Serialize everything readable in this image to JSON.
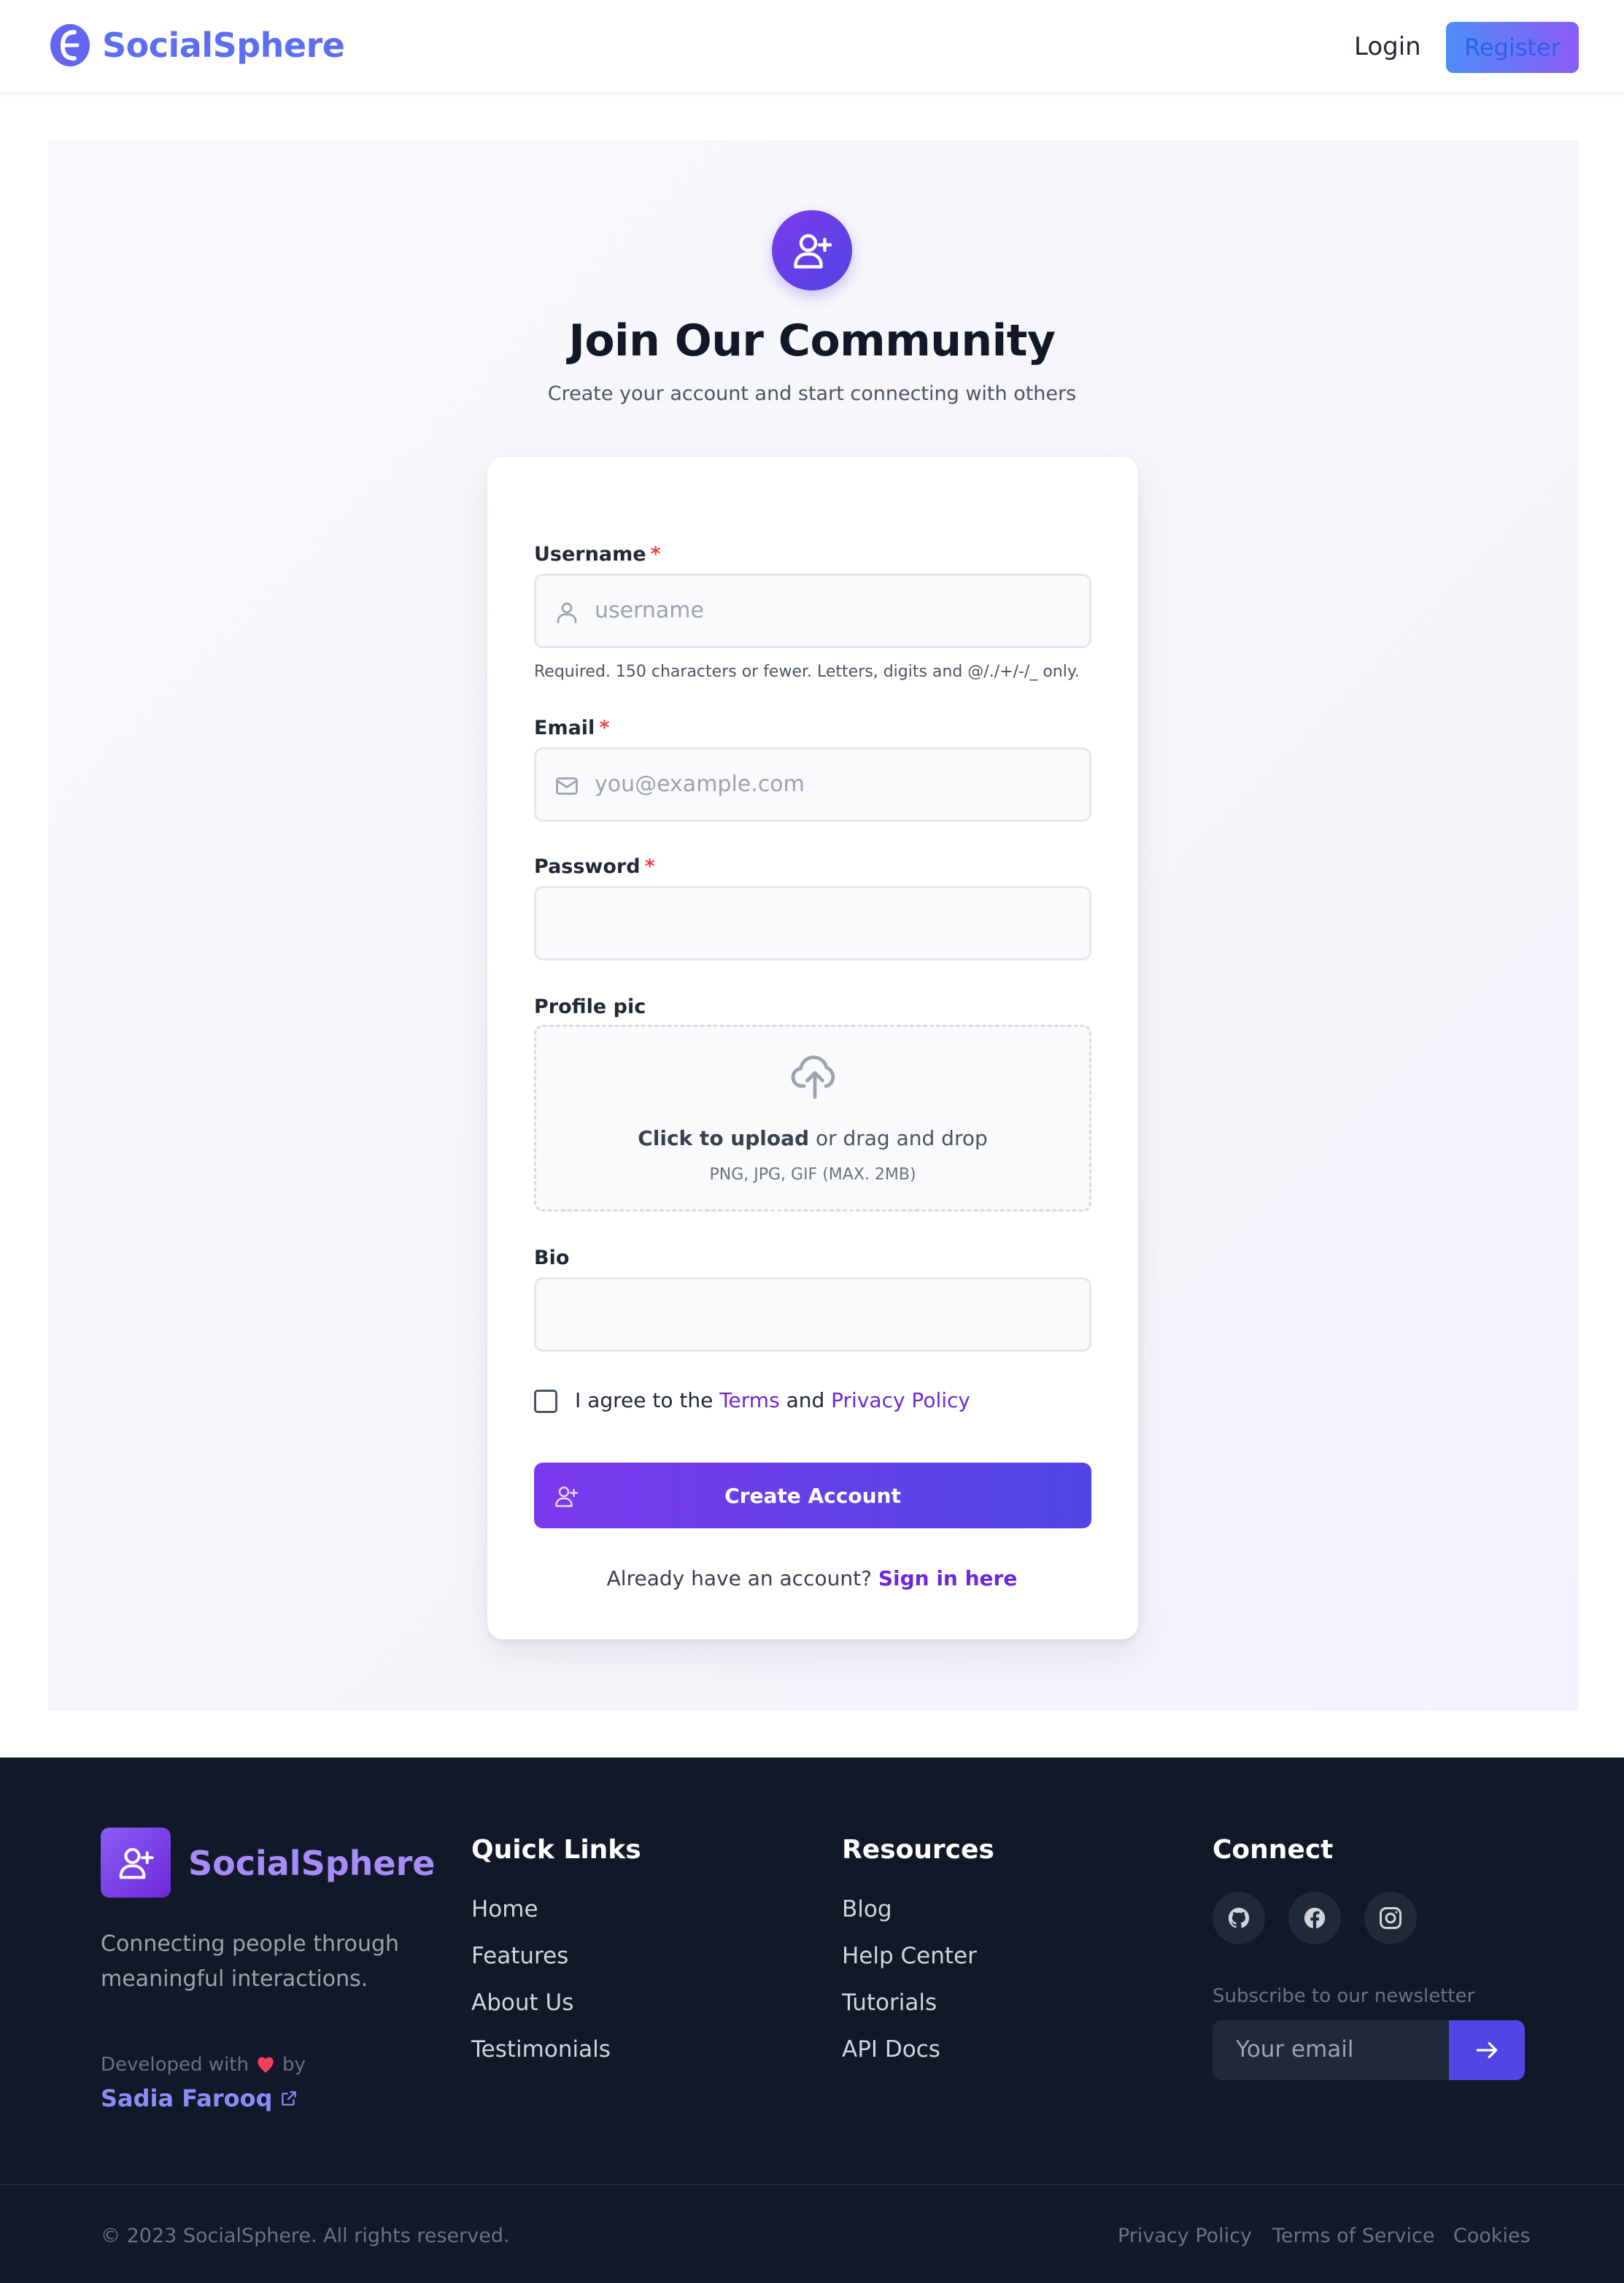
{
  "nav": {
    "brand": "SocialSphere",
    "login": "Login",
    "register": "Register"
  },
  "hero": {
    "title": "Join Our Community",
    "subtitle": "Create your account and start connecting with others"
  },
  "form": {
    "username": {
      "label": "Username",
      "required_mark": "*",
      "placeholder": "username",
      "help": "Required. 150 characters or fewer. Letters, digits and @/./+/-/_ only."
    },
    "email": {
      "label": "Email",
      "required_mark": "*",
      "placeholder": "you@example.com"
    },
    "password": {
      "label": "Password",
      "required_mark": "*"
    },
    "profile_pic": {
      "label": "Profile pic",
      "upload_strong": "Click to upload",
      "upload_rest": " or drag and drop",
      "hint": "PNG, JPG, GIF (MAX. 2MB)"
    },
    "bio": {
      "label": "Bio"
    },
    "agree": {
      "prefix": "I agree to the ",
      "terms": "Terms",
      "and": " and ",
      "privacy": "Privacy Policy"
    },
    "submit": "Create Account",
    "signin_prompt": "Already have an account? ",
    "signin_link": "Sign in here"
  },
  "footer": {
    "brand": "SocialSphere",
    "tagline": "Connecting people through meaningful interactions.",
    "developed_with": "Developed with",
    "by": "by",
    "author": "Sadia Farooq",
    "quick_links": {
      "title": "Quick Links",
      "items": [
        "Home",
        "Features",
        "About Us",
        "Testimonials"
      ]
    },
    "resources": {
      "title": "Resources",
      "items": [
        "Blog",
        "Help Center",
        "Tutorials",
        "API Docs"
      ]
    },
    "connect": {
      "title": "Connect",
      "socials": [
        "github-icon",
        "facebook-icon",
        "instagram-icon"
      ],
      "newsletter_label": "Subscribe to our newsletter",
      "email_placeholder": "Your email"
    },
    "copyright": "© 2023 SocialSphere. All rights reserved.",
    "bottom_links": [
      "Privacy Policy",
      "Terms of Service",
      "Cookies"
    ]
  },
  "colors": {
    "brand": "#5b6ff0",
    "accent_purple": "#7c3aed",
    "accent_indigo": "#4f46e5",
    "footer_bg": "#111827",
    "required": "#ef4444"
  }
}
